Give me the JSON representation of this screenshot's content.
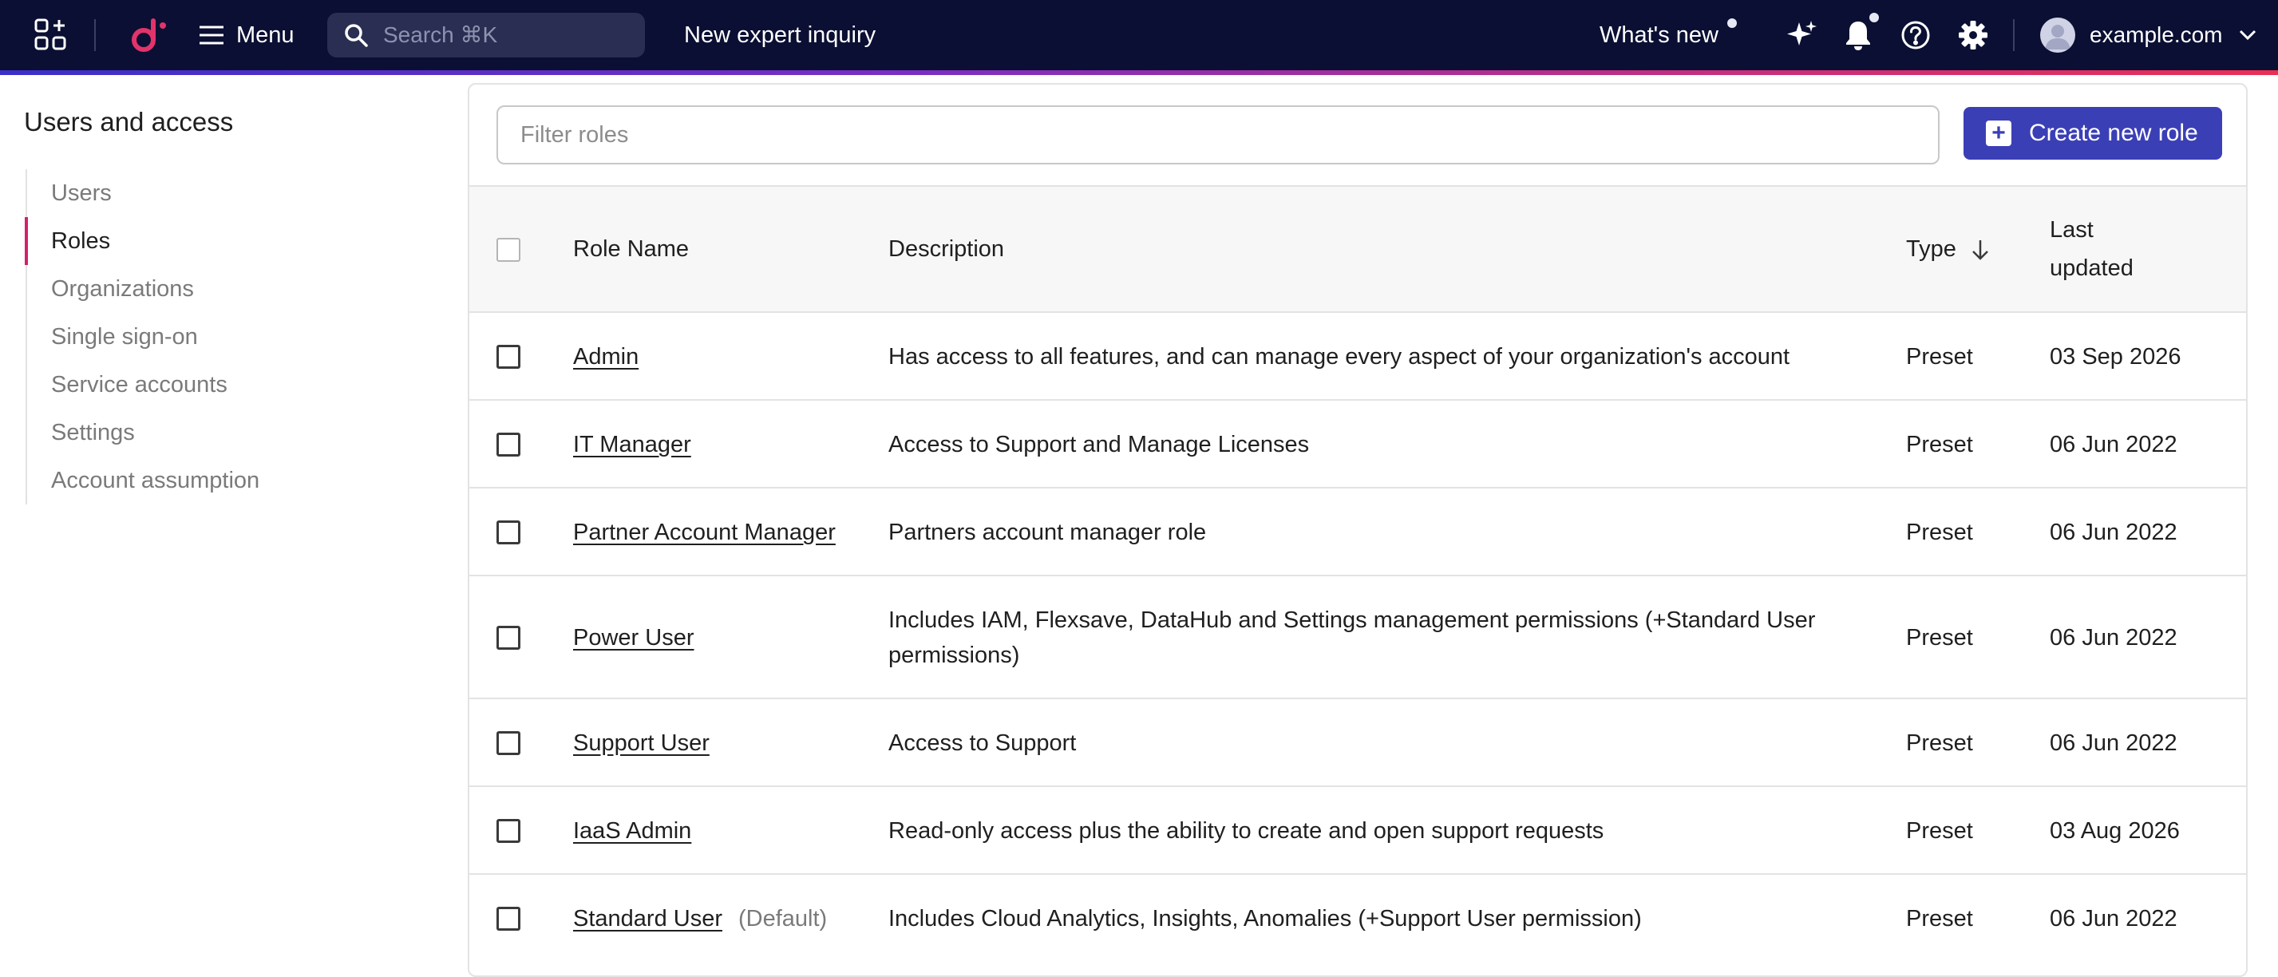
{
  "topbar": {
    "menu_label": "Menu",
    "search_placeholder": "Search ⌘K",
    "inquiry_label": "New expert inquiry",
    "whats_new_label": "What's new",
    "account_label": "example.com"
  },
  "sidebar": {
    "title": "Users and access",
    "items": [
      {
        "label": "Users"
      },
      {
        "label": "Roles"
      },
      {
        "label": "Organizations"
      },
      {
        "label": "Single sign-on"
      },
      {
        "label": "Service accounts"
      },
      {
        "label": "Settings"
      },
      {
        "label": "Account assumption"
      }
    ],
    "active_item": "Roles"
  },
  "main": {
    "filter_placeholder": "Filter roles",
    "create_button_label": "Create new role",
    "columns": {
      "role_name": "Role Name",
      "description": "Description",
      "type": "Type",
      "last_updated_line1": "Last",
      "last_updated_line2": "updated"
    },
    "sort_column": "Type",
    "sort_direction": "descending",
    "rows": [
      {
        "name": "Admin",
        "tag": "",
        "description": "Has access to all features, and can manage every aspect of your organization's account",
        "type": "Preset",
        "updated": "03 Sep 2026"
      },
      {
        "name": "IT Manager",
        "tag": "",
        "description": "Access to Support and Manage Licenses",
        "type": "Preset",
        "updated": "06 Jun 2022"
      },
      {
        "name": "Partner Account Manager",
        "tag": "",
        "description": "Partners account manager role",
        "type": "Preset",
        "updated": "06 Jun 2022"
      },
      {
        "name": "Power User",
        "tag": "",
        "description": "Includes IAM, Flexsave, DataHub and Settings management permissions (+Standard User permissions)",
        "type": "Preset",
        "updated": "06 Jun 2022"
      },
      {
        "name": "Support User",
        "tag": "",
        "description": "Access to Support",
        "type": "Preset",
        "updated": "06 Jun 2022"
      },
      {
        "name": "IaaS Admin",
        "tag": "",
        "description": "Read-only access plus the ability to create and open support requests",
        "type": "Preset",
        "updated": "03 Aug 2026"
      },
      {
        "name": "Standard User",
        "tag": "(Default)",
        "description": "Includes Cloud Analytics, Insights, Anomalies (+Support User permission)",
        "type": "Preset",
        "updated": "06 Jun 2022"
      }
    ]
  },
  "colors": {
    "topbar_bg": "#0b0f33",
    "accent": "#d4206a",
    "primary_button": "#3b3fb6"
  },
  "icons": [
    "apps-icon",
    "logo-icon",
    "menu-icon",
    "search-icon",
    "sparkle-icon",
    "bell-icon",
    "help-icon",
    "gear-icon",
    "avatar",
    "chevron-down-icon",
    "sort-arrow-icon",
    "plus-icon"
  ]
}
